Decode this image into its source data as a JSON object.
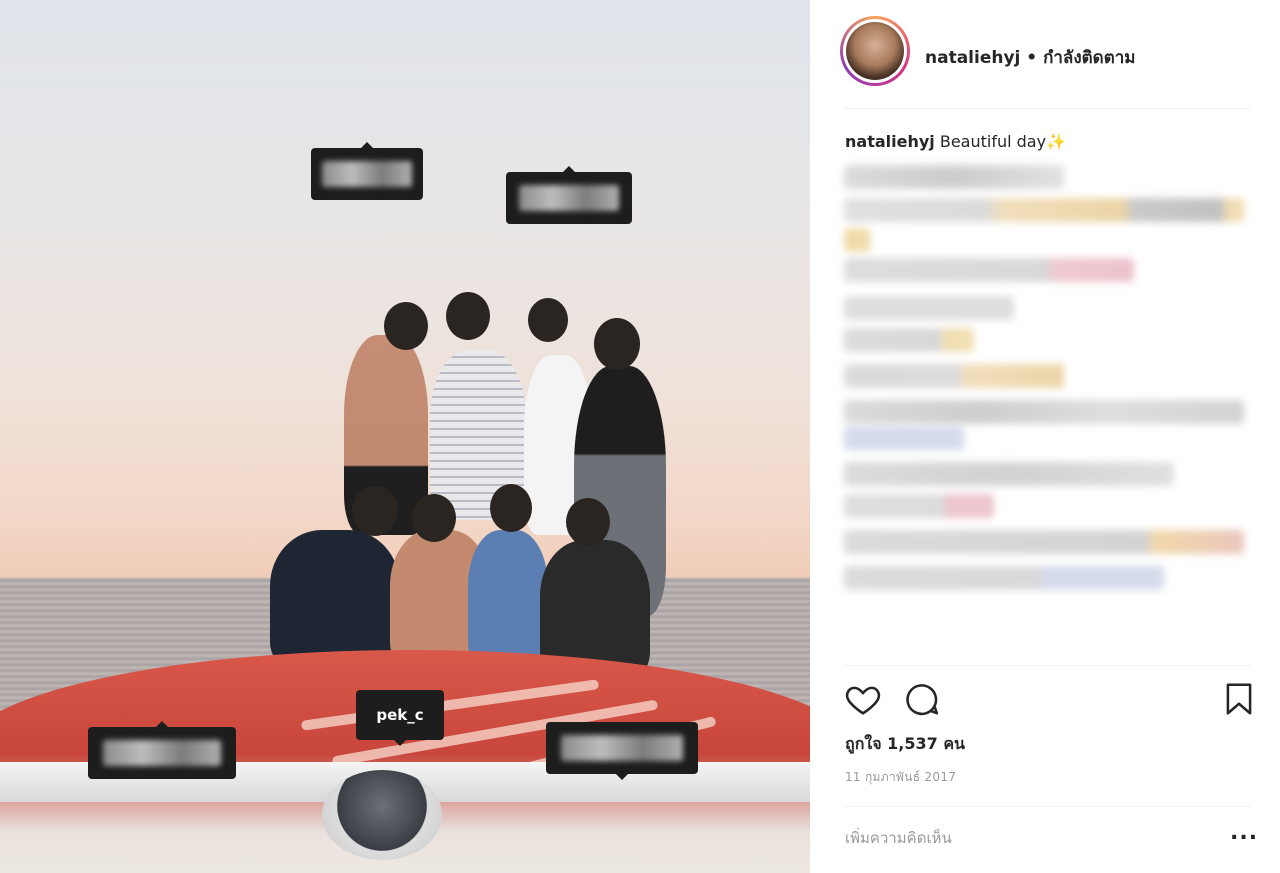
{
  "post": {
    "tags": {
      "visible_tag": "pek_c"
    }
  },
  "header": {
    "username": "nataliehyj",
    "separator": " • ",
    "follow_state": "กำลังติดตาม"
  },
  "caption": {
    "username": "nataliehyj",
    "text": " Beautiful day",
    "emoji": "✨"
  },
  "actions": {
    "like_icon": "heart-icon",
    "comment_icon": "comment-icon",
    "save_icon": "bookmark-icon"
  },
  "likes": {
    "text": "ถูกใจ 1,537 คน"
  },
  "date": {
    "text": "11 กุมภาพันธ์ 2017"
  },
  "comment_box": {
    "placeholder": "เพิ่มความคิดเห็น",
    "more_label": "..."
  },
  "colors": {
    "text": "#262626",
    "muted": "#999999",
    "tag_bg": "#1d1d1d",
    "boat_red": "#d9584a"
  }
}
